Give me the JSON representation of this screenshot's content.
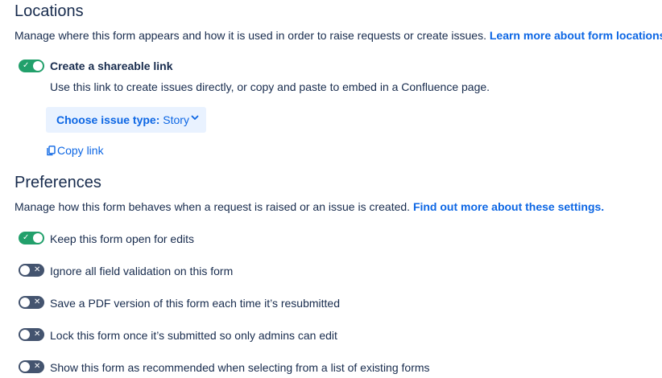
{
  "locations": {
    "title": "Locations",
    "description": "Manage where this form appears and how it is used in order to raise requests or create issues.",
    "learn_more": "Learn more about form locations.",
    "shareable_link": {
      "label": "Create a shareable link",
      "enabled": true,
      "help": "Use this link to create issues directly, or copy and paste to embed in a Confluence page."
    },
    "issue_type": {
      "prefix": "Choose issue type:",
      "value": "Story"
    },
    "copy_link": "Copy link"
  },
  "preferences": {
    "title": "Preferences",
    "description": "Manage how this form behaves when a request is raised or an issue is created.",
    "find_out_more": "Find out more about these settings.",
    "items": [
      {
        "label": "Keep this form open for edits",
        "enabled": true
      },
      {
        "label": "Ignore all field validation on this form",
        "enabled": false
      },
      {
        "label": "Save a PDF version of this form each time it’s resubmitted",
        "enabled": false
      },
      {
        "label": "Lock this form once it’s submitted so only admins can edit",
        "enabled": false
      },
      {
        "label": "Show this form as recommended when selecting from a list of existing forms",
        "enabled": false
      }
    ]
  },
  "colors": {
    "toggle_on": "#22a06b",
    "toggle_off": "#44546f",
    "link": "#0c66e4",
    "dropdown_bg": "#e9f2ff",
    "text": "#172b4d"
  },
  "icons": {
    "toggle_on": "check-icon",
    "toggle_off": "cross-icon",
    "dropdown": "chevron-down-icon",
    "copy": "copy-icon"
  }
}
